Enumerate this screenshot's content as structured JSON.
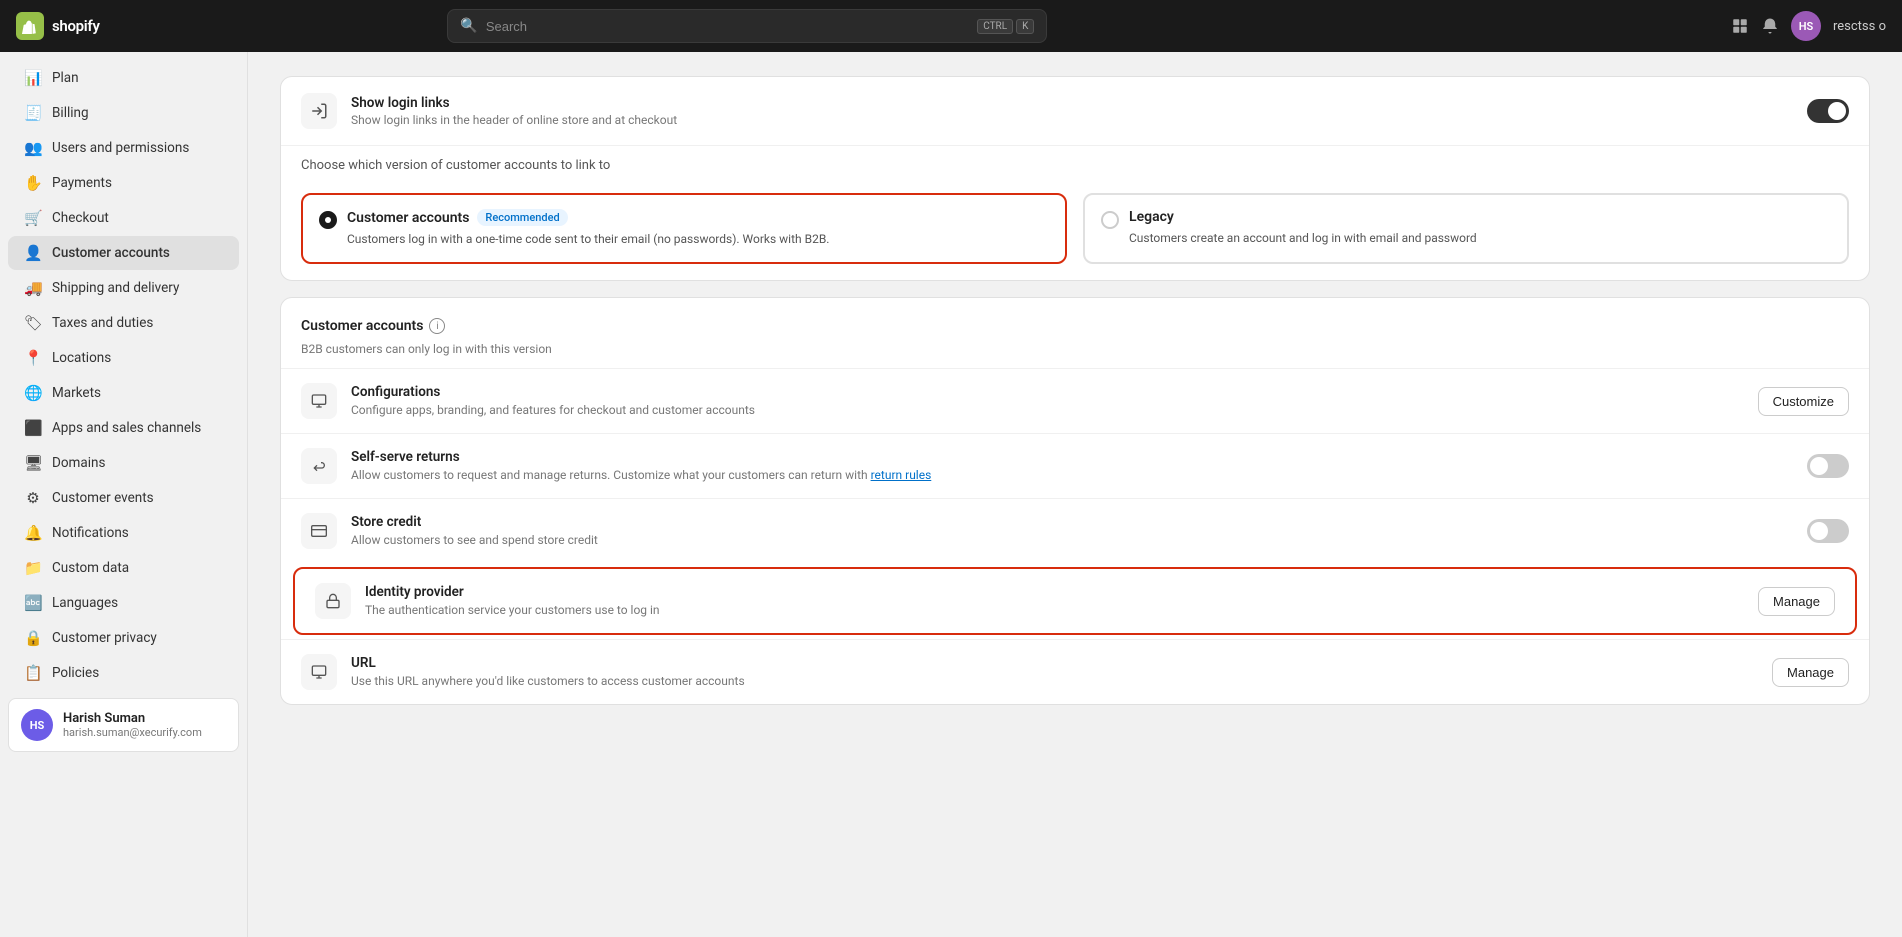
{
  "topnav": {
    "logo_text": "shopify",
    "logo_initial": "S",
    "search_placeholder": "Search",
    "shortcut_ctrl": "CTRL",
    "shortcut_key": "K",
    "avatar_initials": "HS",
    "username": "resctss o"
  },
  "sidebar": {
    "items": [
      {
        "id": "plan",
        "label": "Plan",
        "icon": "📊"
      },
      {
        "id": "billing",
        "label": "Billing",
        "icon": "🧾"
      },
      {
        "id": "users",
        "label": "Users and permissions",
        "icon": "👥"
      },
      {
        "id": "payments",
        "label": "Payments",
        "icon": "✋"
      },
      {
        "id": "checkout",
        "label": "Checkout",
        "icon": "🛒"
      },
      {
        "id": "customer-accounts",
        "label": "Customer accounts",
        "icon": "👤",
        "active": true
      },
      {
        "id": "shipping",
        "label": "Shipping and delivery",
        "icon": "🚚"
      },
      {
        "id": "taxes",
        "label": "Taxes and duties",
        "icon": "🏷"
      },
      {
        "id": "locations",
        "label": "Locations",
        "icon": "📍"
      },
      {
        "id": "markets",
        "label": "Markets",
        "icon": "🌐"
      },
      {
        "id": "apps",
        "label": "Apps and sales channels",
        "icon": "⬛"
      },
      {
        "id": "domains",
        "label": "Domains",
        "icon": "🖥"
      },
      {
        "id": "customer-events",
        "label": "Customer events",
        "icon": "⚙"
      },
      {
        "id": "notifications",
        "label": "Notifications",
        "icon": "🔔"
      },
      {
        "id": "custom-data",
        "label": "Custom data",
        "icon": "📁"
      },
      {
        "id": "languages",
        "label": "Languages",
        "icon": "🔤"
      },
      {
        "id": "customer-privacy",
        "label": "Customer privacy",
        "icon": "🔒"
      },
      {
        "id": "policies",
        "label": "Policies",
        "icon": "📋"
      }
    ],
    "footer": {
      "name": "Harish Suman",
      "email": "harish.suman@xecurify.com",
      "initials": "HS"
    }
  },
  "main": {
    "login_links": {
      "title": "Show login links",
      "desc": "Show login links in the header of online store and at checkout",
      "toggle_on": true
    },
    "version_chooser": {
      "prompt": "Choose which version of customer accounts to link to",
      "options": [
        {
          "id": "new",
          "label": "Customer accounts",
          "badge": "Recommended",
          "desc": "Customers log in with a one-time code sent to their email (no passwords). Works with B2B.",
          "selected": true
        },
        {
          "id": "legacy",
          "label": "Legacy",
          "badge": "",
          "desc": "Customers create an account and log in with email and password",
          "selected": false
        }
      ]
    },
    "customer_accounts_section": {
      "title": "Customer accounts",
      "subtitle": "B2B customers can only log in with this version",
      "features": [
        {
          "id": "configurations",
          "title": "Configurations",
          "desc": "Configure apps, branding, and features for checkout and customer accounts",
          "action_label": "Customize",
          "has_toggle": false,
          "highlighted": false
        },
        {
          "id": "self-serve-returns",
          "title": "Self-serve returns",
          "desc": "Allow customers to request and manage returns. Customize what your customers can return with ",
          "desc_link": "return rules",
          "action_label": "",
          "has_toggle": true,
          "toggle_on": false,
          "highlighted": false
        },
        {
          "id": "store-credit",
          "title": "Store credit",
          "desc": "Allow customers to see and spend store credit",
          "action_label": "",
          "has_toggle": true,
          "toggle_on": false,
          "highlighted": false
        },
        {
          "id": "identity-provider",
          "title": "Identity provider",
          "desc": "The authentication service your customers use to log in",
          "action_label": "Manage",
          "has_toggle": false,
          "highlighted": true
        },
        {
          "id": "url",
          "title": "URL",
          "desc": "Use this URL anywhere you'd like customers to access customer accounts",
          "action_label": "Manage",
          "has_toggle": false,
          "highlighted": false
        }
      ]
    }
  }
}
